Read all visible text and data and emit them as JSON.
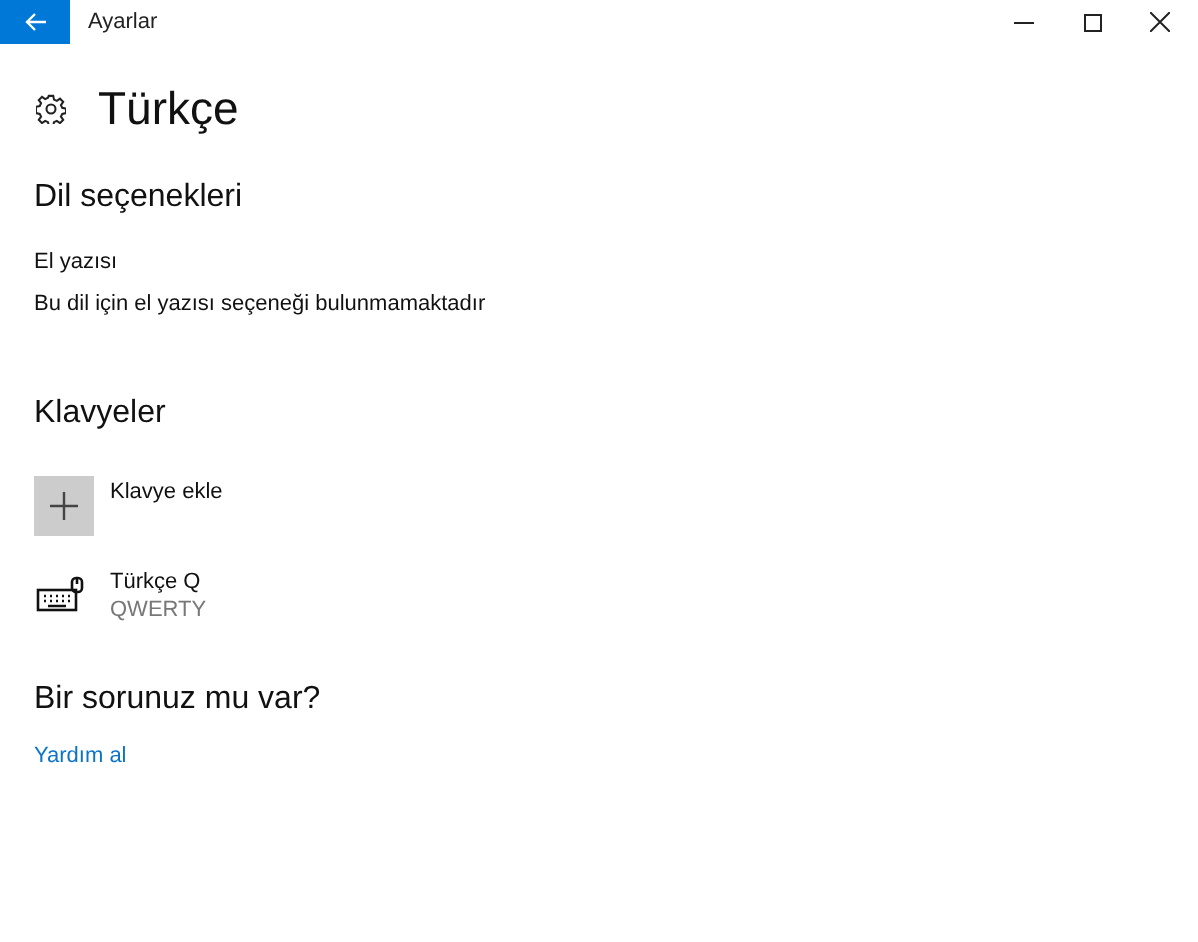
{
  "window": {
    "title": "Ayarlar"
  },
  "page": {
    "title": "Türkçe"
  },
  "language_options": {
    "heading": "Dil seçenekleri",
    "handwriting_label": "El yazısı",
    "handwriting_text": "Bu dil için el yazısı seçeneği bulunmamaktadır"
  },
  "keyboards": {
    "heading": "Klavyeler",
    "add_label": "Klavye ekle",
    "items": [
      {
        "name": "Türkçe Q",
        "layout": "QWERTY"
      }
    ]
  },
  "help": {
    "heading": "Bir sorunuz mu var?",
    "link": "Yardım al"
  }
}
